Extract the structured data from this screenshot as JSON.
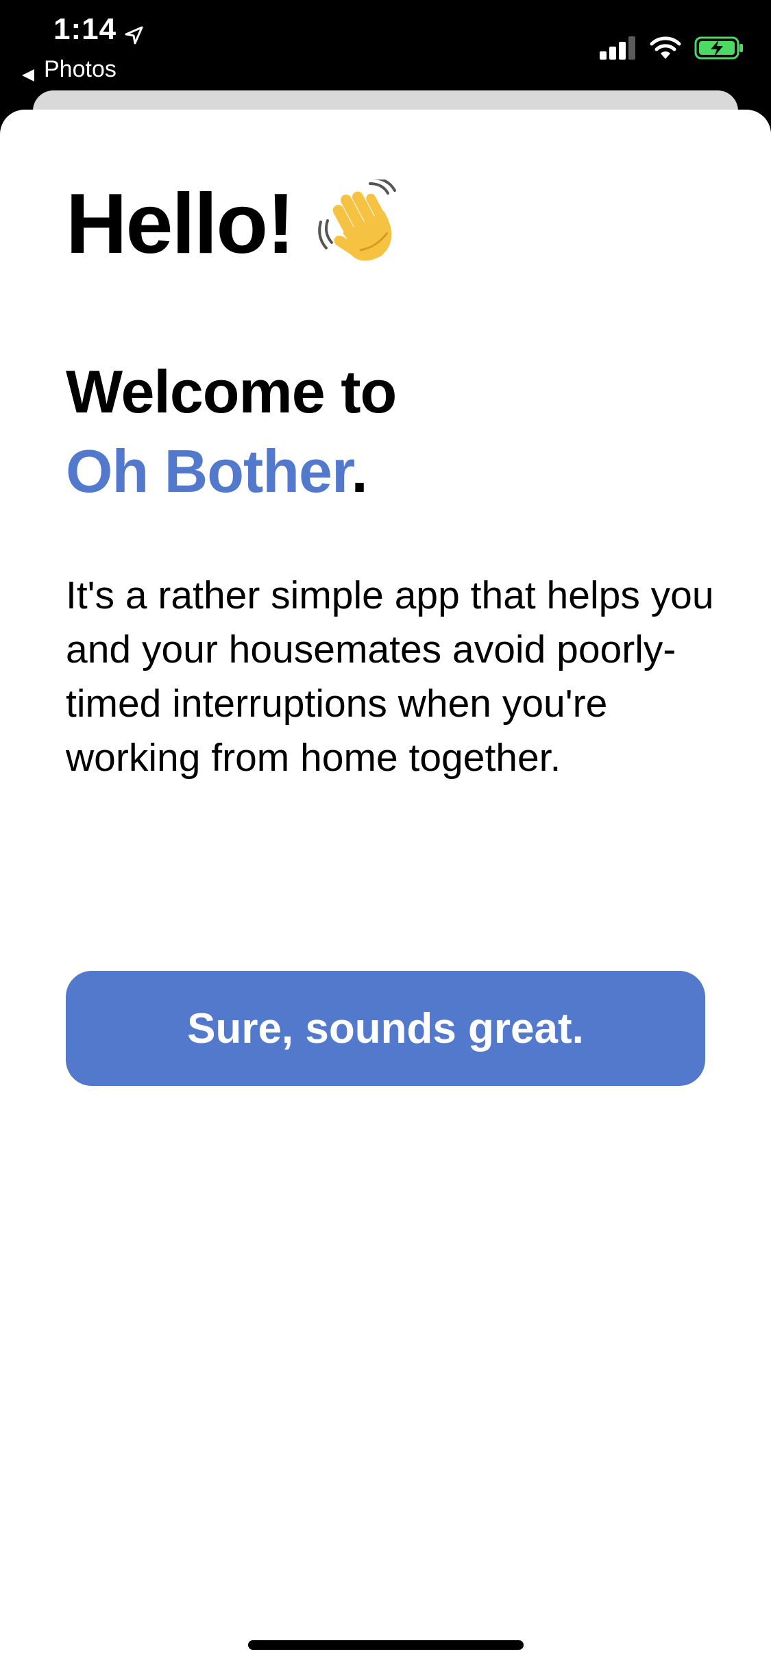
{
  "status_bar": {
    "time": "1:14",
    "back_label": "Photos",
    "location_icon": "location-arrow-icon",
    "signal_icon": "cellular-signal-icon",
    "wifi_icon": "wifi-icon",
    "battery_icon": "battery-charging-icon",
    "battery_color": "#4CD964"
  },
  "welcome": {
    "greeting": "Hello!",
    "greeting_icon": "waving-hand-icon",
    "line1": "Welcome to",
    "app_name": "Oh Bother",
    "app_name_suffix": ".",
    "description": "It's a rather simple app that helps you and your housemates avoid poorly-timed interruptions when you're working from home together."
  },
  "actions": {
    "confirm_label": "Sure, sounds great."
  },
  "colors": {
    "accent": "#5379CD",
    "background": "#FFFFFF",
    "status_bar": "#000000"
  }
}
